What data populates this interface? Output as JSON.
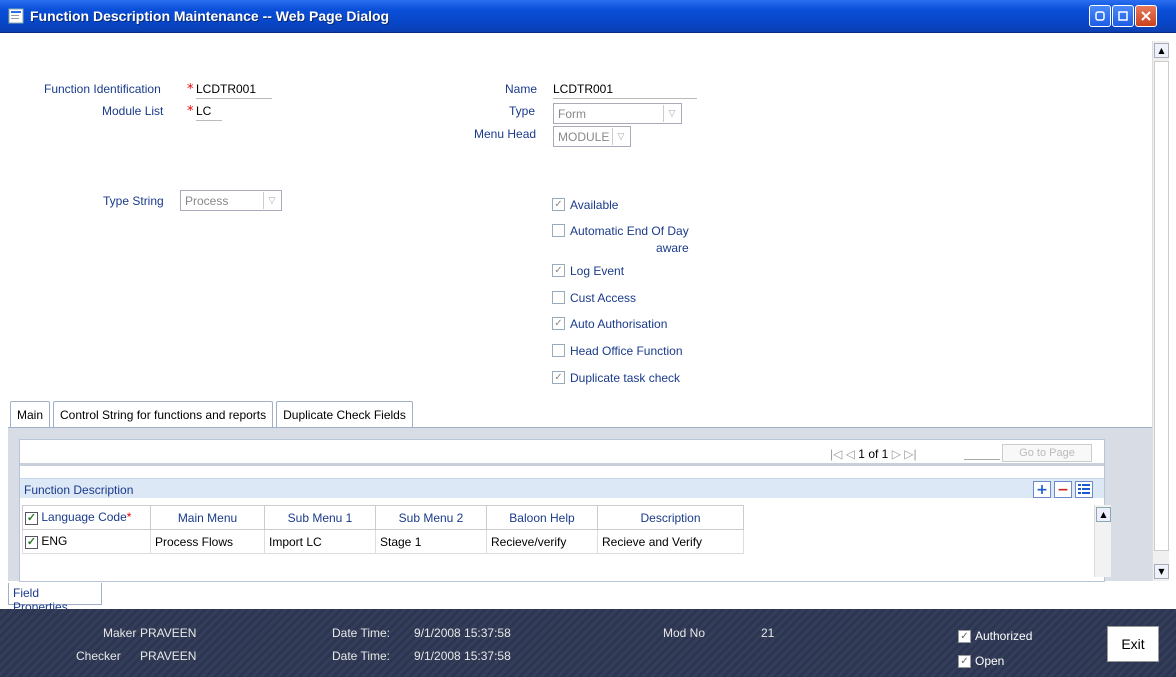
{
  "window": {
    "title": "Function Description Maintenance -- Web Page Dialog"
  },
  "form": {
    "function_id_label": "Function Identification",
    "function_id_value": "LCDTR001",
    "module_list_label": "Module List",
    "module_list_value": "LC",
    "name_label": "Name",
    "name_value": "LCDTR001",
    "type_label": "Type",
    "type_value": "Form",
    "menu_head_label": "Menu Head",
    "menu_head_value": "MODULE",
    "type_string_label": "Type String",
    "type_string_value": "Process",
    "required_marker": "*"
  },
  "checkboxes": [
    {
      "label": "Available",
      "checked": true
    },
    {
      "label": "Automatic End Of Day",
      "label2": "aware",
      "checked": false
    },
    {
      "label": "Log Event",
      "checked": true
    },
    {
      "label": "Cust Access",
      "checked": false
    },
    {
      "label": "Auto Authorisation",
      "checked": true
    },
    {
      "label": "Head Office Function",
      "checked": false
    },
    {
      "label": "Duplicate task check",
      "checked": true
    }
  ],
  "tabs": [
    {
      "label": "Main"
    },
    {
      "label": "Control String for functions and reports"
    },
    {
      "label": "Duplicate Check Fields"
    }
  ],
  "pager": {
    "current": "1",
    "of_label": "of",
    "total": "1",
    "goto_label": "Go to Page"
  },
  "grid": {
    "title": "Function Description",
    "columns": [
      "Language Code",
      "Main Menu",
      "Sub Menu 1",
      "Sub Menu 2",
      "Baloon Help",
      "Description"
    ],
    "rows": [
      [
        "ENG",
        "Process Flows",
        "Import LC",
        "Stage 1",
        "Recieve/verify",
        "Recieve and Verify"
      ]
    ]
  },
  "field_properties_label": "Field Properties",
  "footer": {
    "maker_label": "Maker",
    "maker_value": "PRAVEEN",
    "checker_label": "Checker",
    "checker_value": "PRAVEEN",
    "datetime_label": "Date Time:",
    "maker_datetime": "9/1/2008 15:37:58",
    "checker_datetime": "9/1/2008 15:37:58",
    "mod_no_label": "Mod No",
    "mod_no_value": "21",
    "authorized_label": "Authorized",
    "open_label": "Open",
    "exit_label": "Exit"
  }
}
